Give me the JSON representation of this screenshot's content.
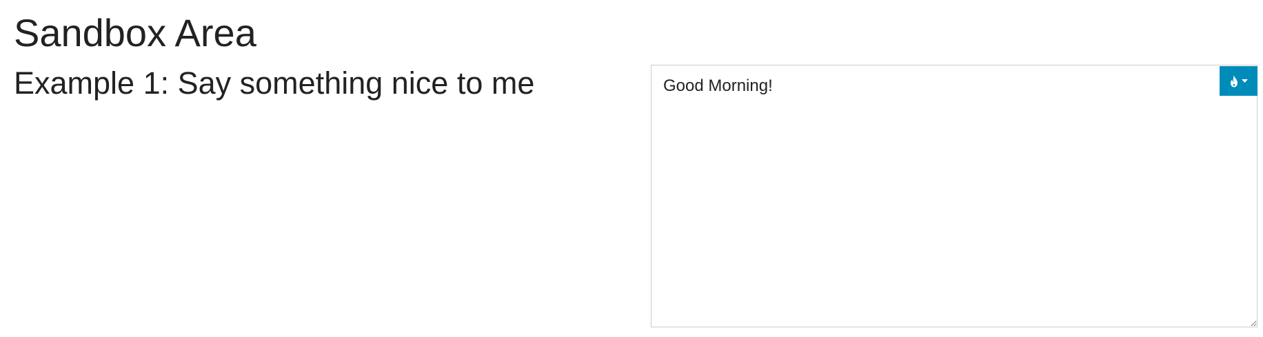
{
  "page": {
    "title": "Sandbox Area"
  },
  "example": {
    "heading": "Example 1: Say something nice to me"
  },
  "editor": {
    "value": "Good Morning!",
    "tool_button": {
      "icon": "flame-icon",
      "caret_icon": "caret-down-icon",
      "color": "#008cba"
    }
  }
}
